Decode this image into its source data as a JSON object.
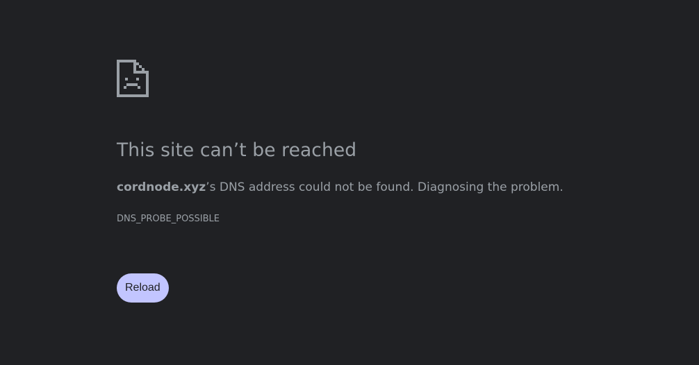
{
  "error_page": {
    "icon": "sad-document-icon",
    "title": "This site can’t be reached",
    "message": {
      "host": "cordnode.xyz",
      "text": "’s DNS address could not be found. Diagnosing the problem."
    },
    "error_code": "DNS_PROBE_POSSIBLE",
    "reload_label": "Reload"
  },
  "colors": {
    "background": "#202124",
    "text": "#9aa0a6",
    "button_bg": "#c2c5ff",
    "button_text": "#202124"
  }
}
